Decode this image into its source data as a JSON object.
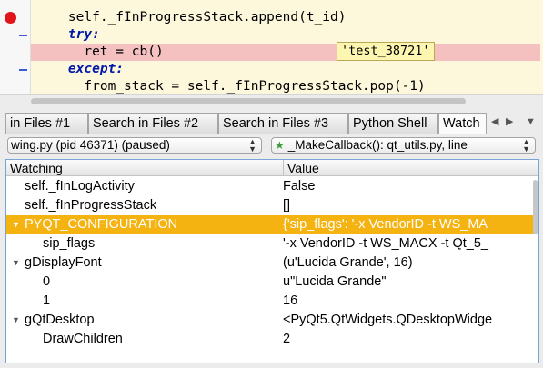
{
  "editor": {
    "lines": [
      {
        "indent": "    ",
        "code": "self._fInProgressStack.append(t_id)"
      },
      {
        "indent": "    ",
        "keyword": "try:"
      },
      {
        "indent": "      ",
        "code": "ret = cb()"
      },
      {
        "indent": "    ",
        "keyword": "except:"
      },
      {
        "indent": "      ",
        "code": "from_stack = self._fInProgressStack.pop(-1)"
      }
    ],
    "tooltip": "'test_38721'"
  },
  "tabs": [
    {
      "label": "in Files #1"
    },
    {
      "label": "Search in Files #2"
    },
    {
      "label": "Search in Files #3"
    },
    {
      "label": "Python Shell"
    },
    {
      "label": "Watch"
    }
  ],
  "toolbar": {
    "process": "wing.py (pid 46371) (paused)",
    "frame": "_MakeCallback(): qt_utils.py, line"
  },
  "watch": {
    "columns": {
      "name": "Watching",
      "value": "Value"
    },
    "rows": [
      {
        "name": "self._fInLogActivity",
        "value": "False",
        "level": 1
      },
      {
        "name": "self._fInProgressStack",
        "value": "[]",
        "level": 1
      },
      {
        "name": "PYQT_CONFIGURATION",
        "value": "{'sip_flags': '-x VendorID -t WS_MA",
        "level": 0,
        "expanded": true,
        "selected": true
      },
      {
        "name": "sip_flags",
        "value": "'-x VendorID -t WS_MACX -t Qt_5_",
        "level": 2
      },
      {
        "name": "gDisplayFont",
        "value": "(u'Lucida Grande', 16)",
        "level": 0,
        "expanded": true
      },
      {
        "name": "0",
        "value": "u\"Lucida Grande\"",
        "level": 2
      },
      {
        "name": "1",
        "value": "16",
        "level": 2
      },
      {
        "name": "gQtDesktop",
        "value": "<PyQt5.QtWidgets.QDesktopWidge",
        "level": 0,
        "expanded": true
      },
      {
        "name": "DrawChildren",
        "value": "2",
        "level": 2
      }
    ]
  },
  "colors": {
    "selection": "#f5b312",
    "breakpoint": "#e2141b",
    "highlight_line": "#f4c0c0",
    "keyword": "#0019aa"
  }
}
